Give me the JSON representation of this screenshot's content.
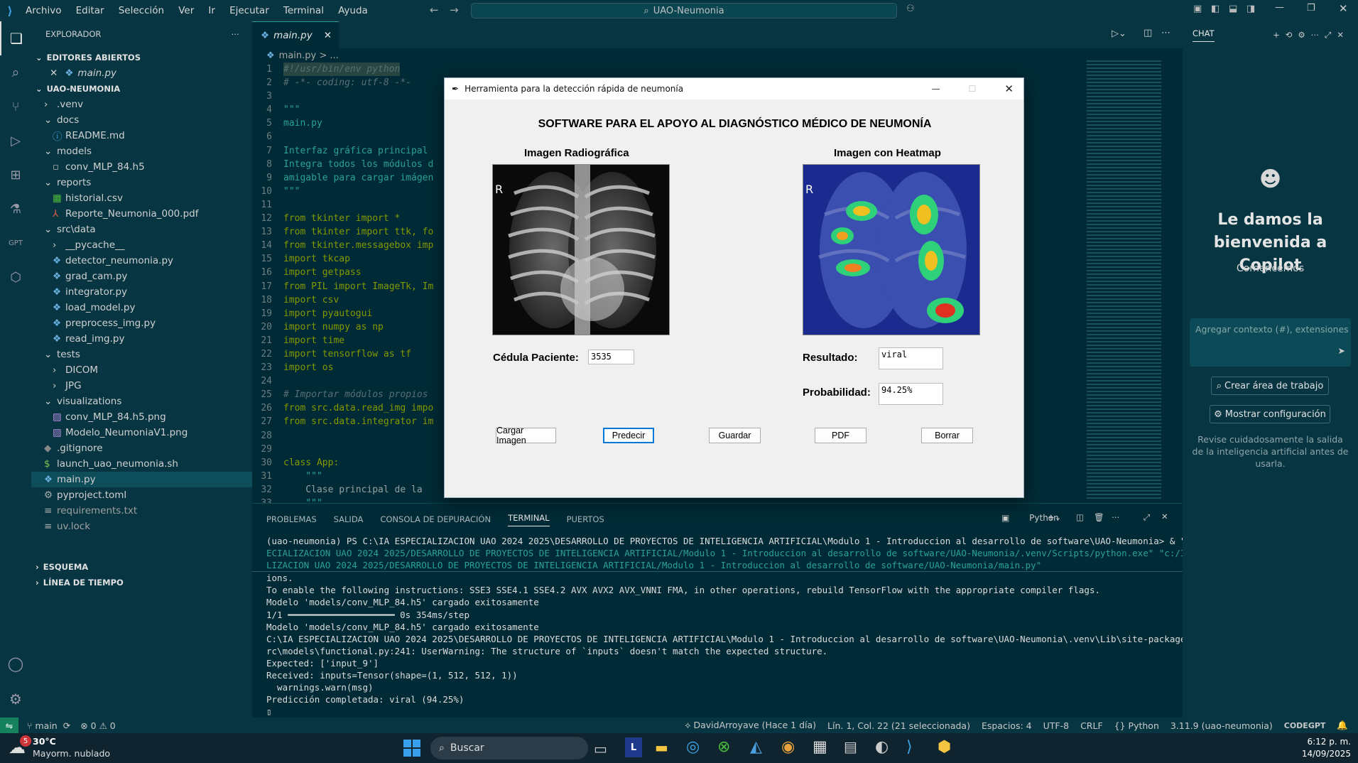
{
  "menu": [
    "Archivo",
    "Editar",
    "Selección",
    "Ver",
    "Ir",
    "Ejecutar",
    "Terminal",
    "Ayuda"
  ],
  "command_center": "UAO-Neumonia",
  "sidebar": {
    "title": "EXPLORADOR",
    "open_editors": "EDITORES ABIERTOS",
    "open_file": "main.py",
    "project": "UAO-NEUMONIA",
    "items": [
      ".venv",
      "docs",
      "README.md",
      "models",
      "conv_MLP_84.h5",
      "reports",
      "historial.csv",
      "Reporte_Neumonia_000.pdf",
      "src\\data",
      "__pycache__",
      "detector_neumonia.py",
      "grad_cam.py",
      "integrator.py",
      "load_model.py",
      "preprocess_img.py",
      "read_img.py",
      "tests",
      "DICOM",
      "JPG",
      "visualizations",
      "conv_MLP_84.h5.png",
      "Modelo_NeumoniaV1.png",
      ".gitignore",
      "launch_uao_neumonia.sh",
      "main.py",
      "pyproject.toml",
      "requirements.txt",
      "uv.lock"
    ],
    "outline": "ESQUEMA",
    "timeline": "LÍNEA DE TIEMPO"
  },
  "editor": {
    "tab": "main.py",
    "breadcrumb": "main.py > ...",
    "lines": [
      "#!/usr/bin/env python",
      "# -*- coding: utf-8 -*-",
      "",
      "\"\"\"",
      "main.py",
      "",
      "Interfaz gráfica principal",
      "Integra todos los módulos d",
      "amigable para cargar imágen",
      "\"\"\"",
      "",
      "from tkinter import *",
      "from tkinter import ttk, fo",
      "from tkinter.messagebox imp",
      "import tkcap",
      "import getpass",
      "from PIL import ImageTk, Im",
      "import csv",
      "import pyautogui",
      "import numpy as np",
      "import time",
      "import tensorflow as tf",
      "import os",
      "",
      "# Importar módulos propios",
      "from src.data.read_img impo",
      "from src.data.integrator im",
      "",
      "",
      "class App:",
      "    \"\"\"",
      "    Clase principal de la",
      "    \"\"\""
    ]
  },
  "dialog": {
    "title": "Herramienta para la detección rápida de neumonía",
    "heading": "SOFTWARE PARA EL APOYO AL DIAGNÓSTICO MÉDICO DE NEUMONÍA",
    "img1_label": "Imagen Radiográfica",
    "img2_label": "Imagen con Heatmap",
    "cedula_label": "Cédula Paciente:",
    "cedula_value": "3535",
    "resultado_label": "Resultado:",
    "resultado_value": "viral",
    "prob_label": "Probabilidad:",
    "prob_value": "94.25%",
    "buttons": [
      "Cargar Imagen",
      "Predecir",
      "Guardar",
      "PDF",
      "Borrar"
    ]
  },
  "panel": {
    "tabs": [
      "PROBLEMAS",
      "SALIDA",
      "CONSOLA DE DEPURACIÓN",
      "TERMINAL",
      "PUERTOS"
    ],
    "shell": "Python",
    "lines": [
      "(uao-neumonia) PS C:\\IA ESPECIALIZACION UAO 2024 2025\\DESARROLLO DE PROYECTOS DE INTELIGENCIA ARTIFICIAL\\Modulo 1 - Introduccion al desarrollo de software\\UAO-Neumonia> & \"c:/IA ESP",
      "ECIALIZACION UAO 2024 2025/DESARROLLO DE PROYECTOS DE INTELIGENCIA ARTIFICIAL/Modulo 1 - Introduccion al desarrollo de software/UAO-Neumonia/.venv/Scripts/python.exe\" \"c:/IA ESPECIA",
      "LIZACION UAO 2024 2025/DESARROLLO DE PROYECTOS DE INTELIGENCIA ARTIFICIAL/Modulo 1 - Introduccion al desarrollo de software/UAO-Neumonia/main.py\"",
      "ions.",
      "To enable the following instructions: SSE3 SSE4.1 SSE4.2 AVX AVX2 AVX_VNNI FMA, in other operations, rebuild TensorFlow with the appropriate compiler flags.",
      "Modelo 'models/conv_MLP_84.h5' cargado exitosamente",
      "1/1 ━━━━━━━━━━━━━━━━━━━━ 0s 354ms/step",
      "Modelo 'models/conv_MLP_84.h5' cargado exitosamente",
      "C:\\IA ESPECIALIZACION UAO 2024 2025\\DESARROLLO DE PROYECTOS DE INTELIGENCIA ARTIFICIAL\\Modulo 1 - Introduccion al desarrollo de software\\UAO-Neumonia\\.venv\\Lib\\site-packages\\keras\\s",
      "rc\\models\\functional.py:241: UserWarning: The structure of `inputs` doesn't match the expected structure.",
      "Expected: ['input_9']",
      "Received: inputs=Tensor(shape=(1, 512, 512, 1))",
      "  warnings.warn(msg)",
      "Predicción completada: viral (94.25%)"
    ]
  },
  "chat": {
    "tab": "CHAT",
    "welcome": "Le damos la bienvenida a Copilot",
    "sub": "Comencemos",
    "input_placeholder": "Agregar contexto (#), extensiones (@",
    "btn1": "Crear área de trabajo",
    "btn2": "Mostrar configuración",
    "disclaimer": "Revise cuidadosamente la salida de la inteligencia artificial antes de usarla."
  },
  "status": {
    "branch": "main",
    "problems": "⊗ 0 ⚠ 0",
    "blame": "DavidArroyave (Hace 1 día)",
    "position": "Lín. 1, Col. 22 (21 seleccionada)",
    "spaces": "Espacios: 4",
    "encoding": "UTF-8",
    "eol": "CRLF",
    "lang": "Python",
    "interp": "3.11.9 (uao-neumonia)",
    "brand": "CODEGPT"
  },
  "taskbar": {
    "temp": "30°C",
    "weather": "Mayorm. nublado",
    "search": "Buscar",
    "time": "6:12 p. m.",
    "date": "14/09/2025",
    "badge": "5"
  }
}
